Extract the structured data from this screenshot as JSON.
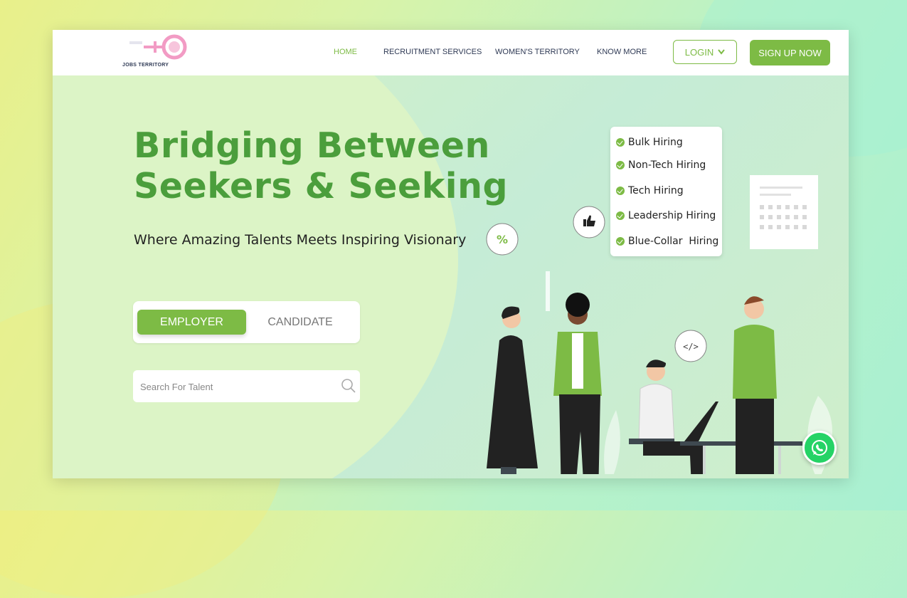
{
  "brand": {
    "logo_text": "JOBS TERRITORY"
  },
  "nav": {
    "items": [
      {
        "label": "HOME",
        "active": true
      },
      {
        "label": "RECRUITMENT SERVICES",
        "active": false
      },
      {
        "label": "WOMEN'S TERRITORY",
        "active": false
      },
      {
        "label": "KNOW MORE",
        "active": false
      }
    ],
    "login_label": "LOGIN",
    "signup_label": "SIGN UP NOW"
  },
  "hero": {
    "headline_line1": "Bridging Between",
    "headline_line2": "Seekers & Seeking",
    "subheadline": "Where Amazing Talents Meets Inspiring Visionary",
    "toggle": {
      "employer_label": "EMPLOYER",
      "candidate_label": "CANDIDATE",
      "selected": "EMPLOYER"
    },
    "search": {
      "placeholder": "Search For Talent",
      "value": ""
    }
  },
  "hiring_list": [
    "Bulk Hiring",
    "Non-Tech Hiring",
    "Tech Hiring",
    "Leadership Hiring",
    "Blue-Collar  Hiring"
  ],
  "illustration": {
    "percent_bubble": "%",
    "code_bubble": "</>"
  },
  "colors": {
    "accent": "#7dbb45",
    "headline": "#4b9e3c",
    "nav_text": "#2f3a55",
    "logo_pink": "#f29bc4",
    "whatsapp": "#25d366"
  }
}
